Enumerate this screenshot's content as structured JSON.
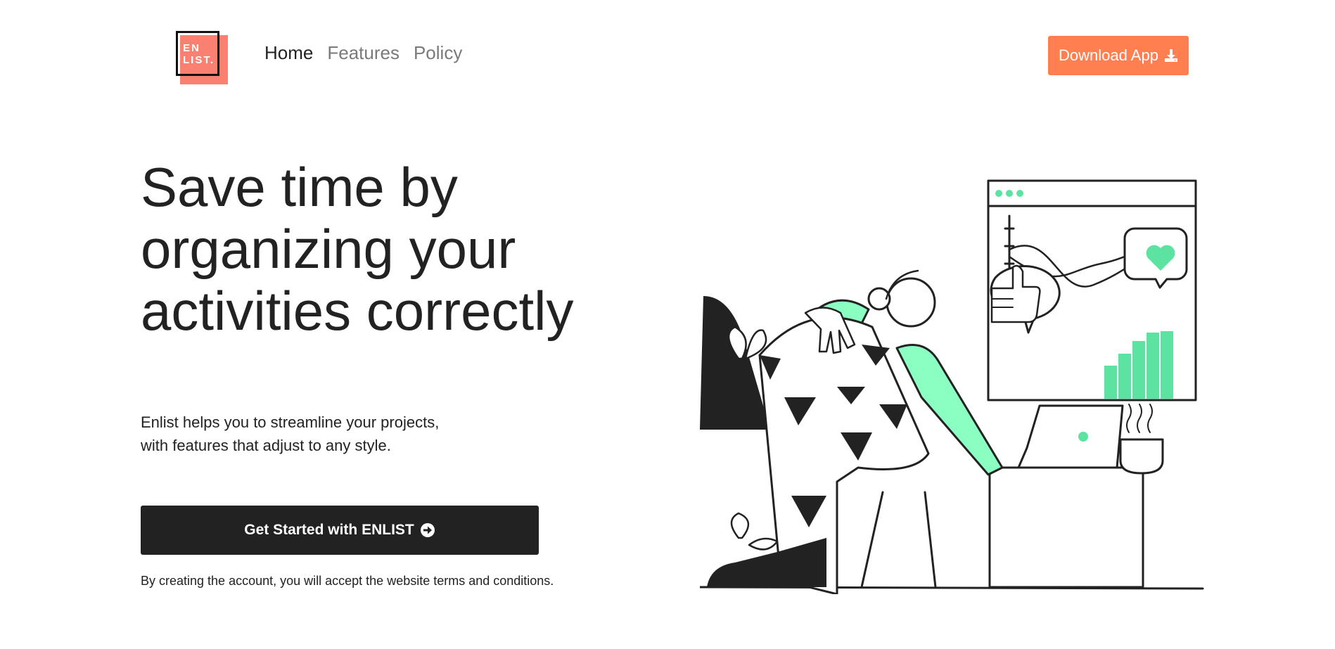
{
  "brand": {
    "logo_text_line1": "EN",
    "logo_text_line2": "LIST.",
    "accent": "#fa8072"
  },
  "nav": {
    "items": [
      {
        "label": "Home",
        "active": true
      },
      {
        "label": "Features",
        "active": false
      },
      {
        "label": "Policy",
        "active": false
      }
    ]
  },
  "header": {
    "download_label": "Download App",
    "download_icon": "download-icon",
    "download_color": "#ff7f50"
  },
  "hero": {
    "title": "Save time by organizing your activities correctly",
    "subtitle_line1": "Enlist helps you to streamline your projects,",
    "subtitle_line2": "with features that adjust to any style.",
    "cta_label": "Get Started with ENLIST",
    "cta_icon": "arrow-circle-right-icon",
    "terms": "By creating the account, you will accept the website terms and conditions."
  },
  "illustration": {
    "accent": "#5de3a1",
    "ink": "#222222"
  }
}
